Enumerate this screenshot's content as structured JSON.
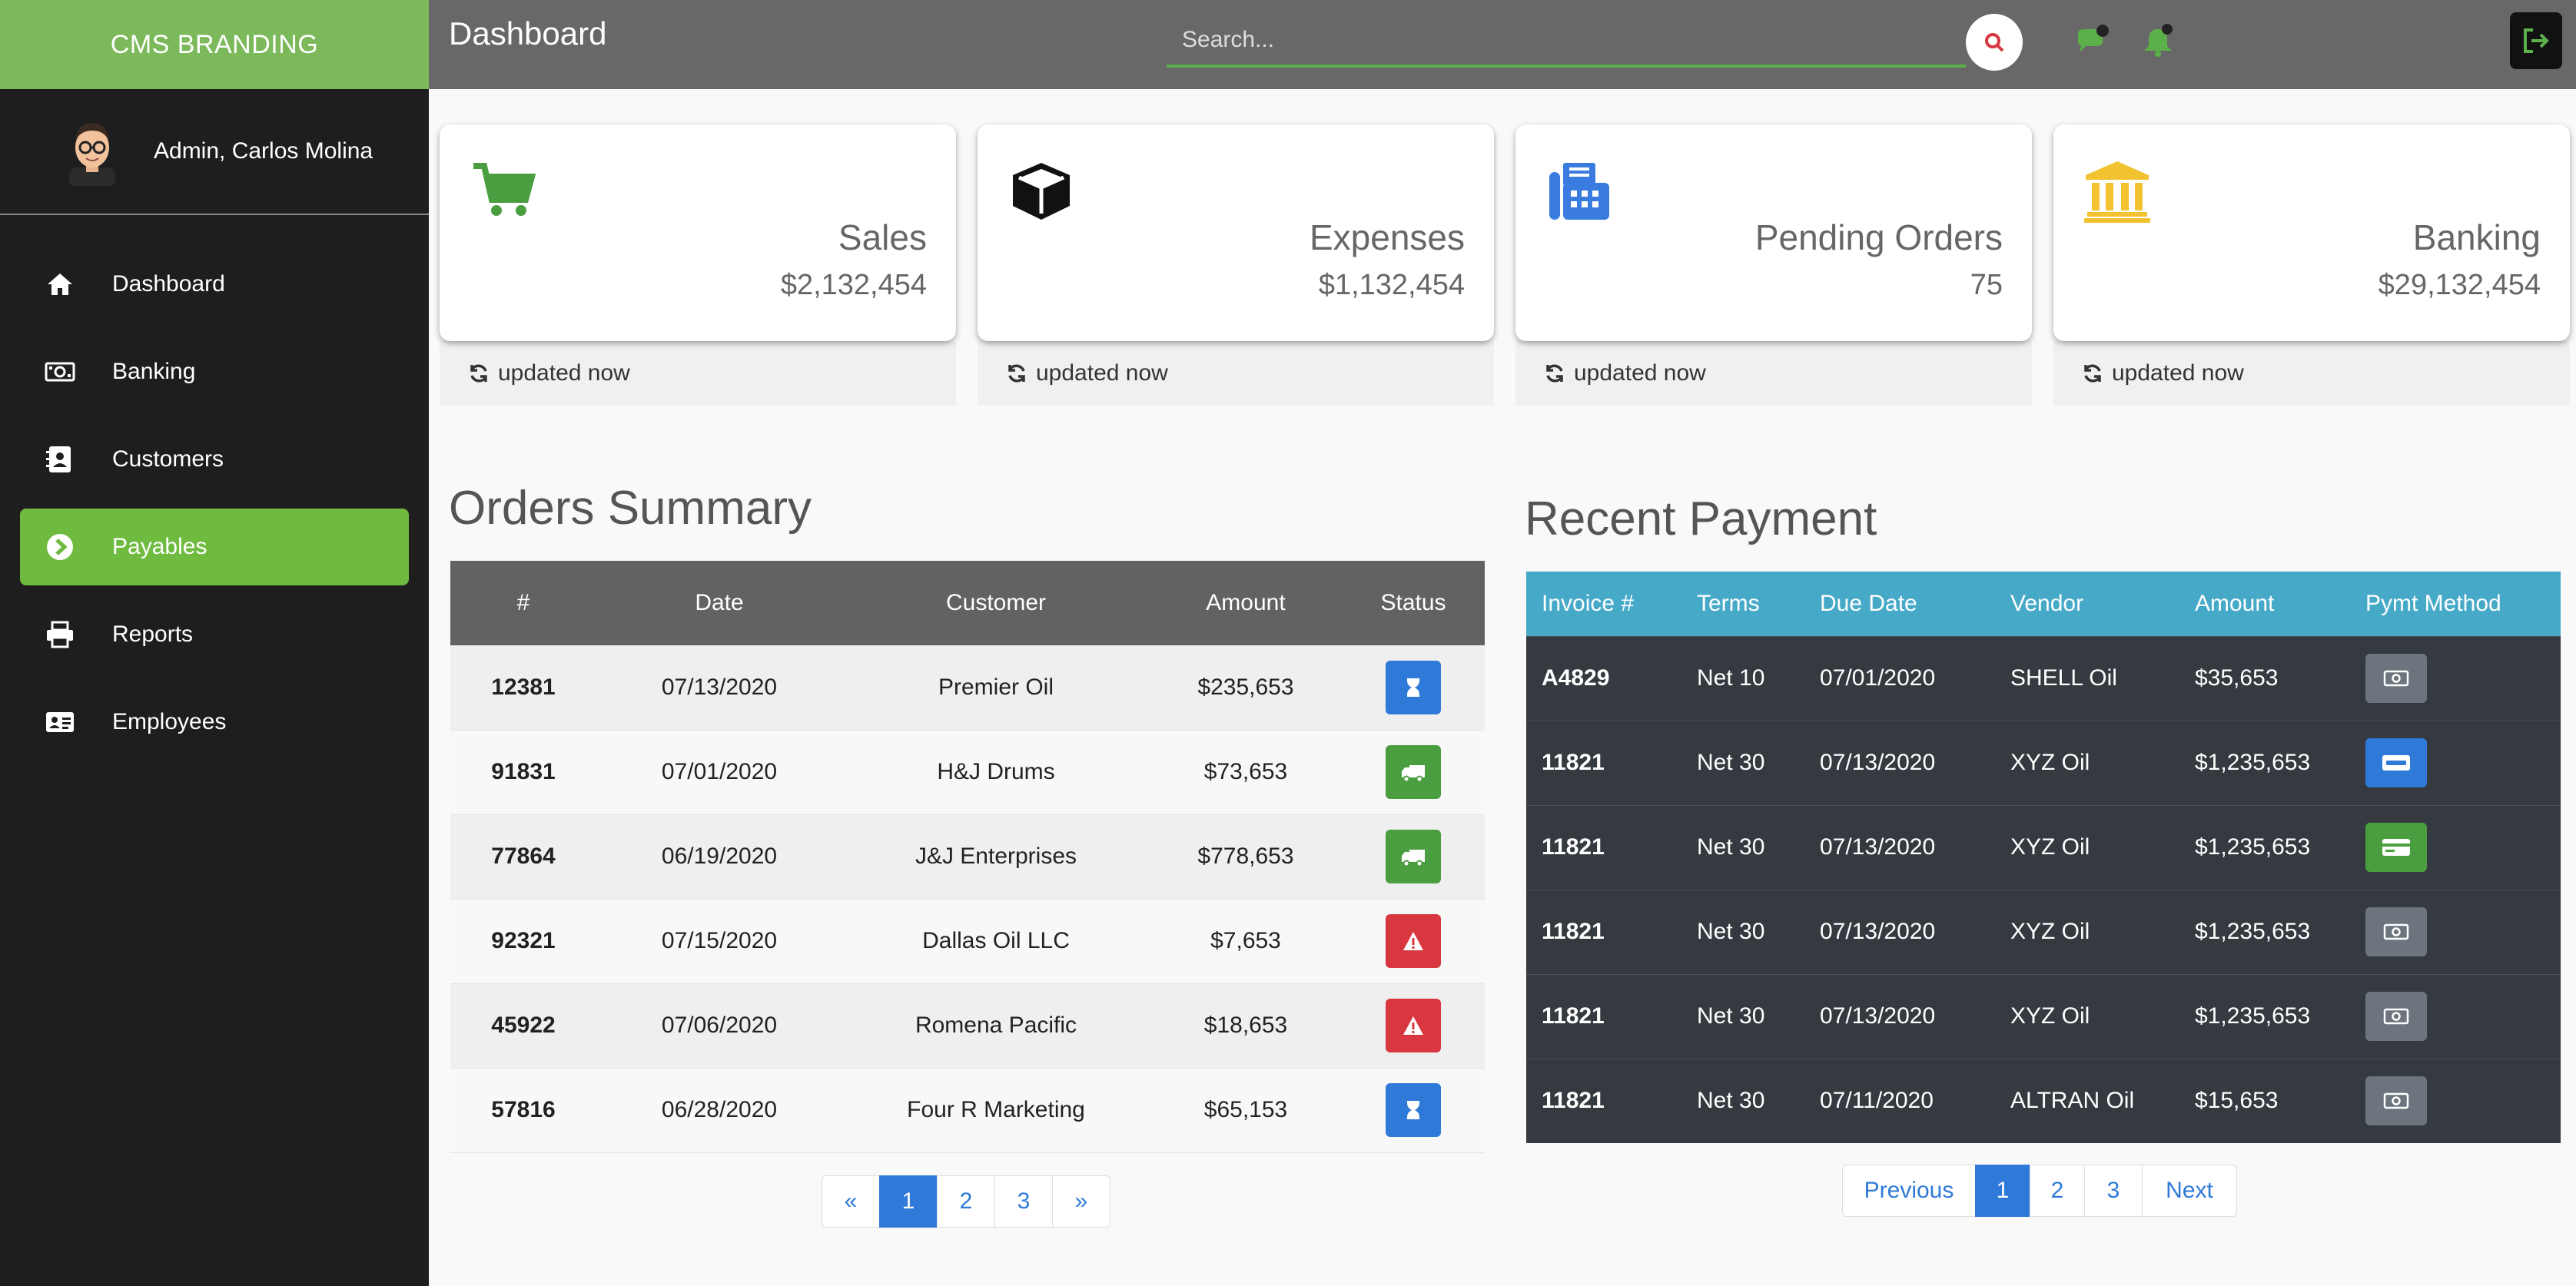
{
  "brand": "CMS BRANDING",
  "profile": {
    "name": "Admin, Carlos Molina"
  },
  "sidebar": {
    "items": [
      {
        "label": "Dashboard",
        "icon": "home-icon"
      },
      {
        "label": "Banking",
        "icon": "money-icon"
      },
      {
        "label": "Customers",
        "icon": "address-book-icon"
      },
      {
        "label": "Payables",
        "icon": "arrow-circle-icon",
        "active": true
      },
      {
        "label": "Reports",
        "icon": "printer-icon"
      },
      {
        "label": "Employees",
        "icon": "id-card-icon"
      }
    ]
  },
  "header": {
    "title": "Dashboard",
    "search_placeholder": "Search..."
  },
  "cards": [
    {
      "title": "Sales",
      "value": "$2,132,454",
      "footer": "updated now",
      "icon": "cart-icon",
      "color": "#4a9e3f"
    },
    {
      "title": "Expenses",
      "value": "$1,132,454",
      "footer": "updated now",
      "icon": "box-icon",
      "color": "#111111"
    },
    {
      "title": "Pending Orders",
      "value": "75",
      "footer": "updated now",
      "icon": "fax-icon",
      "color": "#3a7be0"
    },
    {
      "title": "Banking",
      "value": "$29,132,454",
      "footer": "updated now",
      "icon": "bank-icon",
      "color": "#f2c230"
    }
  ],
  "orders": {
    "title": "Orders Summary",
    "columns": [
      "#",
      "Date",
      "Customer",
      "Amount",
      "Status"
    ],
    "rows": [
      {
        "id": "12381",
        "date": "07/13/2020",
        "customer": "Premier Oil",
        "amount": "$235,653",
        "status": "pending"
      },
      {
        "id": "91831",
        "date": "07/01/2020",
        "customer": "H&J Drums",
        "amount": "$73,653",
        "status": "shipped"
      },
      {
        "id": "77864",
        "date": "06/19/2020",
        "customer": "J&J Enterprises",
        "amount": "$778,653",
        "status": "shipped"
      },
      {
        "id": "92321",
        "date": "07/15/2020",
        "customer": "Dallas Oil LLC",
        "amount": "$7,653",
        "status": "alert"
      },
      {
        "id": "45922",
        "date": "07/06/2020",
        "customer": "Romena Pacific",
        "amount": "$18,653",
        "status": "alert"
      },
      {
        "id": "57816",
        "date": "06/28/2020",
        "customer": "Four R Marketing",
        "amount": "$65,153",
        "status": "pending"
      }
    ],
    "pager": [
      "«",
      "1",
      "2",
      "3",
      "»"
    ],
    "pager_active": "1"
  },
  "payments": {
    "title": "Recent Payment",
    "columns": [
      "Invoice #",
      "Terms",
      "Due Date",
      "Vendor",
      "Amount",
      "Pymt Method"
    ],
    "rows": [
      {
        "invoice": "A4829",
        "terms": "Net 10",
        "due": "07/01/2020",
        "vendor": "SHELL Oil",
        "amount": "$35,653",
        "method": "cash"
      },
      {
        "invoice": "11821",
        "terms": "Net 30",
        "due": "07/13/2020",
        "vendor": "XYZ Oil",
        "amount": "$1,235,653",
        "method": "paypal"
      },
      {
        "invoice": "11821",
        "terms": "Net 30",
        "due": "07/13/2020",
        "vendor": "XYZ Oil",
        "amount": "$1,235,653",
        "method": "card"
      },
      {
        "invoice": "11821",
        "terms": "Net 30",
        "due": "07/13/2020",
        "vendor": "XYZ Oil",
        "amount": "$1,235,653",
        "method": "cash"
      },
      {
        "invoice": "11821",
        "terms": "Net 30",
        "due": "07/13/2020",
        "vendor": "XYZ Oil",
        "amount": "$1,235,653",
        "method": "cash"
      },
      {
        "invoice": "11821",
        "terms": "Net 30",
        "due": "07/11/2020",
        "vendor": "ALTRAN Oil",
        "amount": "$15,653",
        "method": "cash"
      }
    ],
    "pager": [
      "Previous",
      "1",
      "2",
      "3",
      "Next"
    ],
    "pager_active": "1"
  },
  "colors": {
    "brand_green": "#7cb95a",
    "active_nav": "#6fbb3f",
    "header_gray": "#696868",
    "status_pending": "#2f7ad8",
    "status_shipped": "#4a9e3f",
    "status_alert": "#d9373f",
    "pay_header": "#46a9c8"
  }
}
